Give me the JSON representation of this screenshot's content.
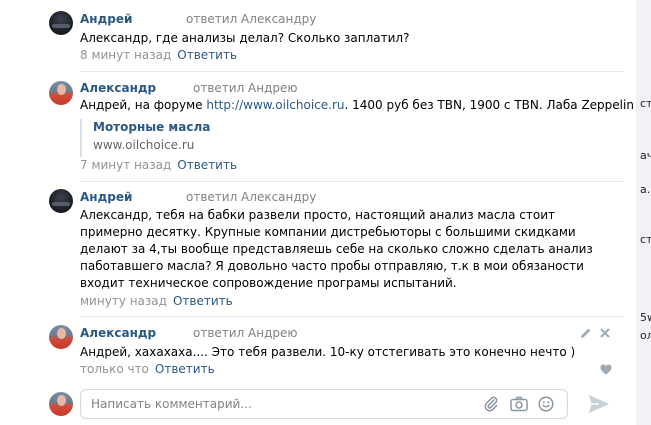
{
  "comments": [
    {
      "author": "Андрей",
      "reply_to": "ответил Александру",
      "text": "Александр, где анализы делал? Сколько заплатил?",
      "time": "8 минут назад",
      "reply_label": "Ответить"
    },
    {
      "author": "Александр",
      "reply_to": "ответил Андрею",
      "text_prefix": "Андрей, на форуме ",
      "text_link": "http://www.oilchoice.ru",
      "text_suffix": ". 1400 руб без TBN, 1900 с TBN. Лаба Zeppelin",
      "attachment": {
        "title": "Моторные масла",
        "url": "www.oilchoice.ru"
      },
      "time": "7 минут назад",
      "reply_label": "Ответить"
    },
    {
      "author": "Андрей",
      "reply_to": "ответил Александру",
      "text": "Александр, тебя на бабки развели просто, настоящий анализ масла стоит примерно десятку. Крупные компании дистребьюторы с большими скидками делают за 4,ты вообще представляешь себе на сколько сложно сделать анализ паботавшего масла? Я довольно часто пробы отправляю, т.к в мои обязаности входит техническое сопровождение програмы испытаний.",
      "time": "минуту назад",
      "reply_label": "Ответить"
    },
    {
      "author": "Александр",
      "reply_to": "ответил Андрею",
      "text": "Андрей, хахахаха.... Это тебя развели. 10-ку отстегивать это конечно нечто )",
      "time": "только что",
      "reply_label": "Ответить"
    }
  ],
  "composer": {
    "placeholder": "Написать комментарий..."
  },
  "right_strip_fragments": [
    "ст",
    "aч",
    "a.",
    "ст",
    "5w",
    "ол"
  ],
  "colors": {
    "link": "#2a5885",
    "meta": "#939393",
    "divider": "#e7e8ec"
  }
}
